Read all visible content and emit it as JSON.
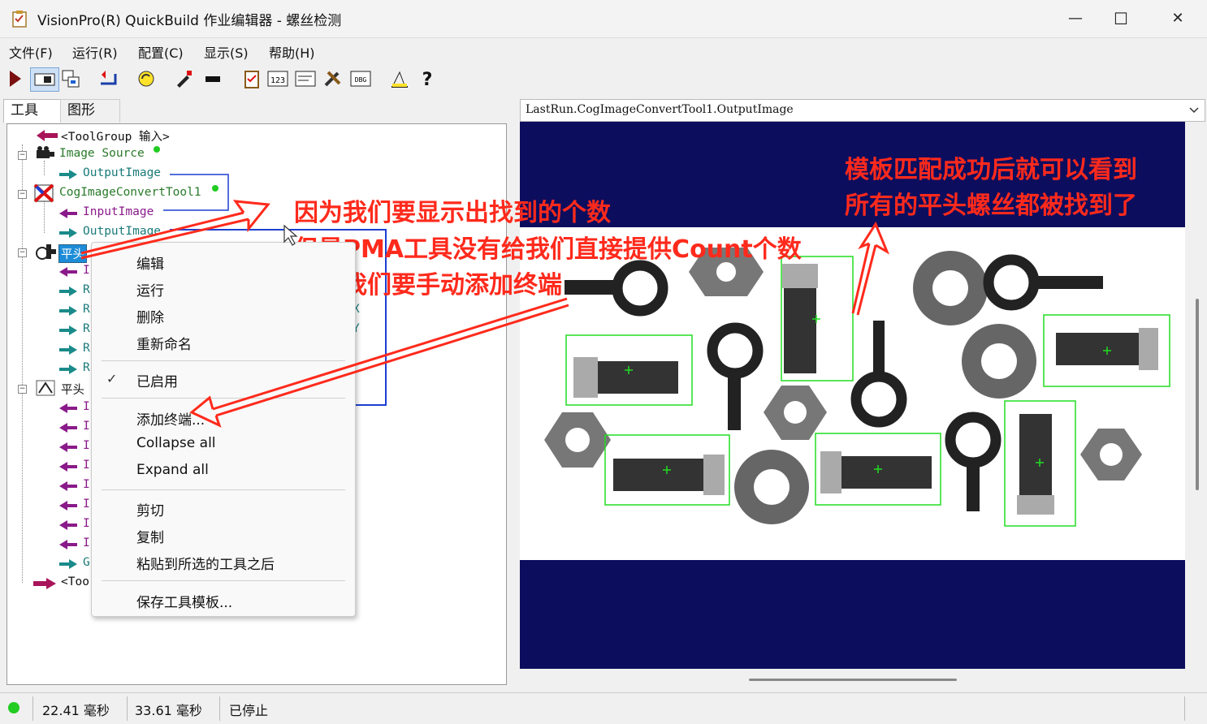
{
  "window": {
    "title": "VisionPro(R) QuickBuild 作业编辑器 - 螺丝检测",
    "minimize_glyph": "—",
    "maximize_glyph": "☐",
    "close_glyph": "✕"
  },
  "menu": [
    "文件(F)",
    "运行(R)",
    "配置(C)",
    "显示(S)",
    "帮助(H)"
  ],
  "toolbar_icons": [
    "run-icon",
    "toolbar-image-icon",
    "toolbar-copy-icon",
    "toolbar-import-icon",
    "toolbar-refresh-icon",
    "toolbar-pen-icon",
    "toolbar-link-icon",
    "toolbar-clipboard-icon",
    "toolbar-123-icon",
    "toolbar-form-icon",
    "toolbar-tools-icon",
    "toolbar-dbg-icon",
    "toolbar-measure-icon",
    "help-icon"
  ],
  "toolbar_text": {
    "num": "123",
    "dbg": "DBG",
    "help": "?"
  },
  "left_tabs": [
    "工具",
    "图形"
  ],
  "tree": {
    "group_input": "<ToolGroup 输入>",
    "image_source": "Image Source",
    "output_image": "OutputImage",
    "convert_tool": "CogImageConvertTool1",
    "input_image": "InputImage",
    "output_image2": "OutputImage",
    "pma_tool": "平头",
    "flat_head": "平头",
    "child_i": "I",
    "child_r": "R",
    "child_g": "G",
    "group_output": "<Too",
    "partial_x": "X",
    "partial_y": "Y"
  },
  "context_menu": {
    "edit": "编辑",
    "run": "运行",
    "delete": "删除",
    "rename": "重新命名",
    "enabled": "已启用",
    "enabled_check": "✓",
    "add_terminal": "添加终端...",
    "collapse_all": "Collapse all",
    "expand_all": "Expand all",
    "cut": "剪切",
    "copy": "复制",
    "paste_after": "粘贴到所选的工具之后",
    "save_template": "保存工具模板..."
  },
  "image_selector": {
    "value": "LastRun.CogImageConvertTool1.OutputImage"
  },
  "annotations": {
    "left_line1": "因为我们要显示出找到的个数",
    "left_line2": "但是PMA工具没有给我们直接提供Count个数",
    "left_line3": "所以我们要手动添加终端",
    "right_line1": "模板匹配成功后就可以看到",
    "right_line2": "所有的平头螺丝都被找到了"
  },
  "status": {
    "time1": "22.41 毫秒",
    "time2": "33.61 毫秒",
    "state": "已停止",
    "indicator_color": "#22cc22"
  },
  "colors": {
    "annotation_red": "#ff2a1c",
    "display_bg": "#0d0d5e",
    "match_box": "#22dd22",
    "arrow_teal": "#1a8a8a",
    "arrow_purple": "#8a1a8a"
  }
}
